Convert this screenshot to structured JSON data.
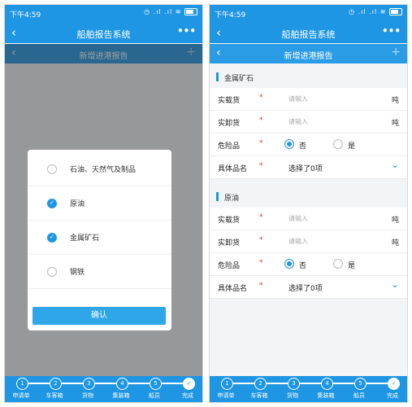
{
  "status": {
    "time": "下午4:59",
    "icons": "◷ .ıl .ıl ≋"
  },
  "app": {
    "title": "船舶报告系统",
    "more": "•••",
    "back": "‹"
  },
  "subpage": {
    "title": "新增进港报告",
    "back": "‹",
    "add": "+"
  },
  "picker": {
    "options": [
      {
        "label": "石油、天然气及制品",
        "checked": false
      },
      {
        "label": "原油",
        "checked": true
      },
      {
        "label": "金属矿石",
        "checked": true
      },
      {
        "label": "钢铁",
        "checked": false
      }
    ],
    "confirm_label": "确认"
  },
  "form": {
    "sections": [
      {
        "title": "金属矿石",
        "loaded_label": "实载货",
        "unloaded_label": "实卸货",
        "placeholder": "请输入",
        "unit": "吨",
        "dangerous_label": "危险品",
        "no_label": "否",
        "yes_label": "是",
        "dangerous": "否",
        "product_label": "具体品名",
        "product_value": "选择了0项"
      },
      {
        "title": "原油",
        "loaded_label": "实载货",
        "unloaded_label": "实卸货",
        "placeholder": "请输入",
        "unit": "吨",
        "dangerous_label": "危险品",
        "no_label": "否",
        "yes_label": "是",
        "dangerous": "否",
        "product_label": "具体品名",
        "product_value": "选择了0项"
      }
    ],
    "required_mark": "*"
  },
  "steps": [
    {
      "number": "1",
      "label": "申请单"
    },
    {
      "number": "2",
      "label": "车客箱"
    },
    {
      "number": "3",
      "label": "货物"
    },
    {
      "number": "4",
      "label": "集装箱"
    },
    {
      "number": "5",
      "label": "船员"
    },
    {
      "number": "✓",
      "label": "完成"
    }
  ],
  "colors": {
    "primary": "#1f96e4",
    "required": "#e2352a"
  }
}
